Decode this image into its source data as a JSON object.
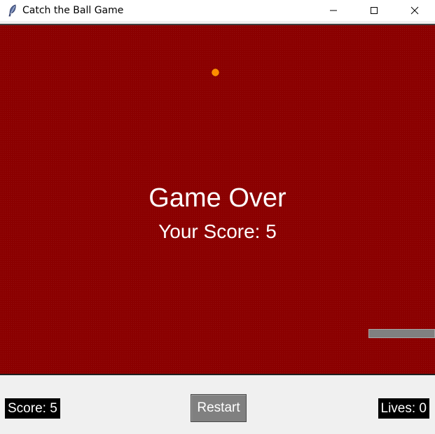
{
  "window": {
    "title": "Catch the Ball Game",
    "app_icon": "feather-icon",
    "controls": {
      "minimize_icon": "minimize-icon",
      "maximize_icon": "maximize-icon",
      "close_icon": "close-icon"
    }
  },
  "game": {
    "background_color": "#8b0000",
    "game_over_text": "Game Over",
    "final_score_text": "Your Score: 5",
    "ball_color": "#ff8c00",
    "paddle_color": "#808080"
  },
  "status": {
    "score_text": "Score: 5",
    "lives_text": "Lives: 0",
    "restart_label": "Restart"
  }
}
